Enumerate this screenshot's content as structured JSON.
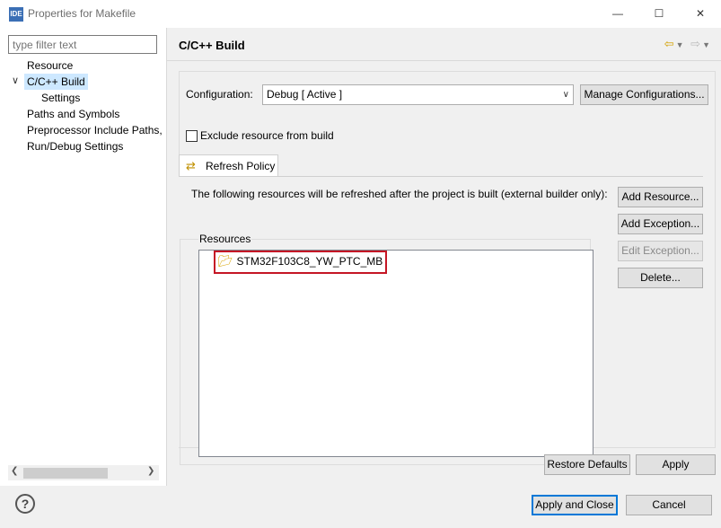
{
  "window": {
    "app_icon_text": "IDE",
    "title": "Properties for Makefile",
    "minimize": "—",
    "maximize": "☐",
    "close": "✕"
  },
  "left": {
    "filter_placeholder": "type filter text",
    "tree": [
      {
        "label": "Resource"
      },
      {
        "label": "C/C++ Build",
        "expanded": true,
        "selected": true
      },
      {
        "label": "Settings"
      },
      {
        "label": "Paths and Symbols"
      },
      {
        "label": "Preprocessor Include Paths,"
      },
      {
        "label": "Run/Debug Settings"
      }
    ]
  },
  "page": {
    "title": "C/C++ Build",
    "configuration_label": "Configuration:",
    "configuration_value": "Debug  [ Active ]",
    "manage_button": "Manage Configurations...",
    "exclude_label": "Exclude resource from build",
    "exclude_checked": false,
    "tab_label": "Refresh Policy",
    "description": "The following resources will be refreshed after the project is built (external builder only):",
    "resources_legend": "Resources",
    "resources": [
      "STM32F103C8_YW_PTC_MB"
    ],
    "buttons": {
      "add_resource": "Add Resource...",
      "add_exception": "Add Exception...",
      "edit_exception": "Edit Exception...",
      "delete": "Delete..."
    },
    "restore_defaults": "Restore Defaults",
    "apply": "Apply"
  },
  "footer": {
    "help_icon": "?",
    "apply_and_close": "Apply and Close",
    "cancel": "Cancel"
  },
  "colors": {
    "selection": "#cde8ff",
    "highlight_border": "#c51625",
    "primary_button_border": "#0078d7"
  }
}
